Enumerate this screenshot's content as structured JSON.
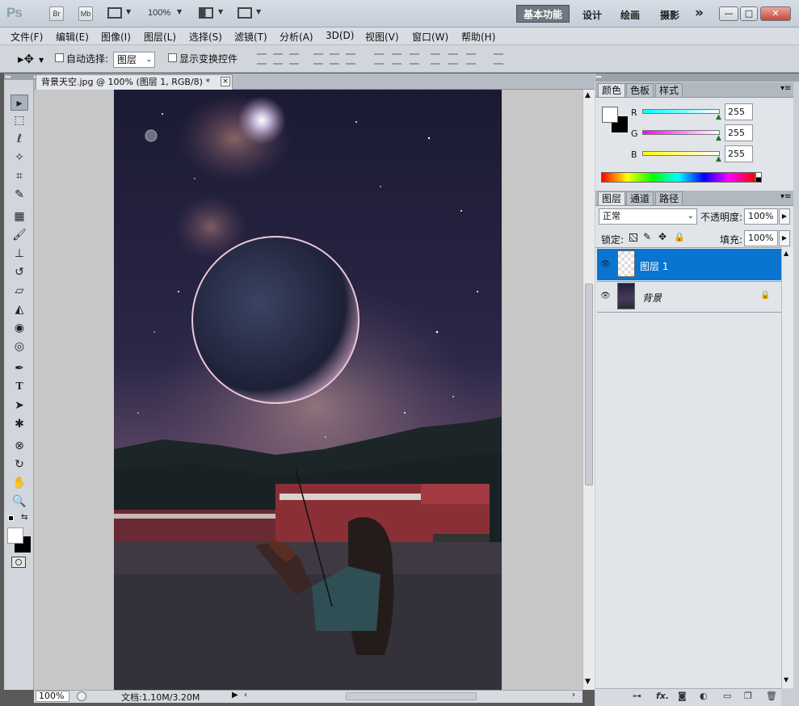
{
  "app": {
    "logo": "Ps",
    "bridge_label": "Br",
    "minibridge_label": "Mb",
    "zoom_value": "100%",
    "workspaces": [
      "基本功能",
      "设计",
      "绘画",
      "摄影"
    ],
    "active_workspace": "基本功能",
    "more_label": "»"
  },
  "menu": [
    "文件(F)",
    "编辑(E)",
    "图像(I)",
    "图层(L)",
    "选择(S)",
    "滤镜(T)",
    "分析(A)",
    "3D(D)",
    "视图(V)",
    "窗口(W)",
    "帮助(H)"
  ],
  "options": {
    "auto_select_label": "自动选择:",
    "auto_select_value": "图层",
    "show_transform_label": "显示变换控件"
  },
  "document": {
    "tab_title": "背景天空.jpg @ 100% (图层 1, RGB/8) *",
    "close_glyph": "×",
    "zoom": "100%",
    "info": "文档:1.10M/3.20M"
  },
  "color_panel": {
    "tabs": [
      "颜色",
      "色板",
      "样式"
    ],
    "channels": [
      {
        "label": "R",
        "value": "255"
      },
      {
        "label": "G",
        "value": "255"
      },
      {
        "label": "B",
        "value": "255"
      }
    ]
  },
  "layers_panel": {
    "tabs": [
      "图层",
      "通道",
      "路径"
    ],
    "blend_mode": "正常",
    "opacity_label": "不透明度:",
    "opacity_value": "100%",
    "lock_label": "锁定:",
    "fill_label": "填充:",
    "fill_value": "100%",
    "layers": [
      {
        "name": "图层 1",
        "selected": true
      },
      {
        "name": "背景",
        "selected": false,
        "locked": true
      }
    ]
  },
  "colors": {
    "selection": "#0a75d0",
    "ui_gray": "#d1d6dc",
    "canvas_bg": "#c7c7c7"
  }
}
